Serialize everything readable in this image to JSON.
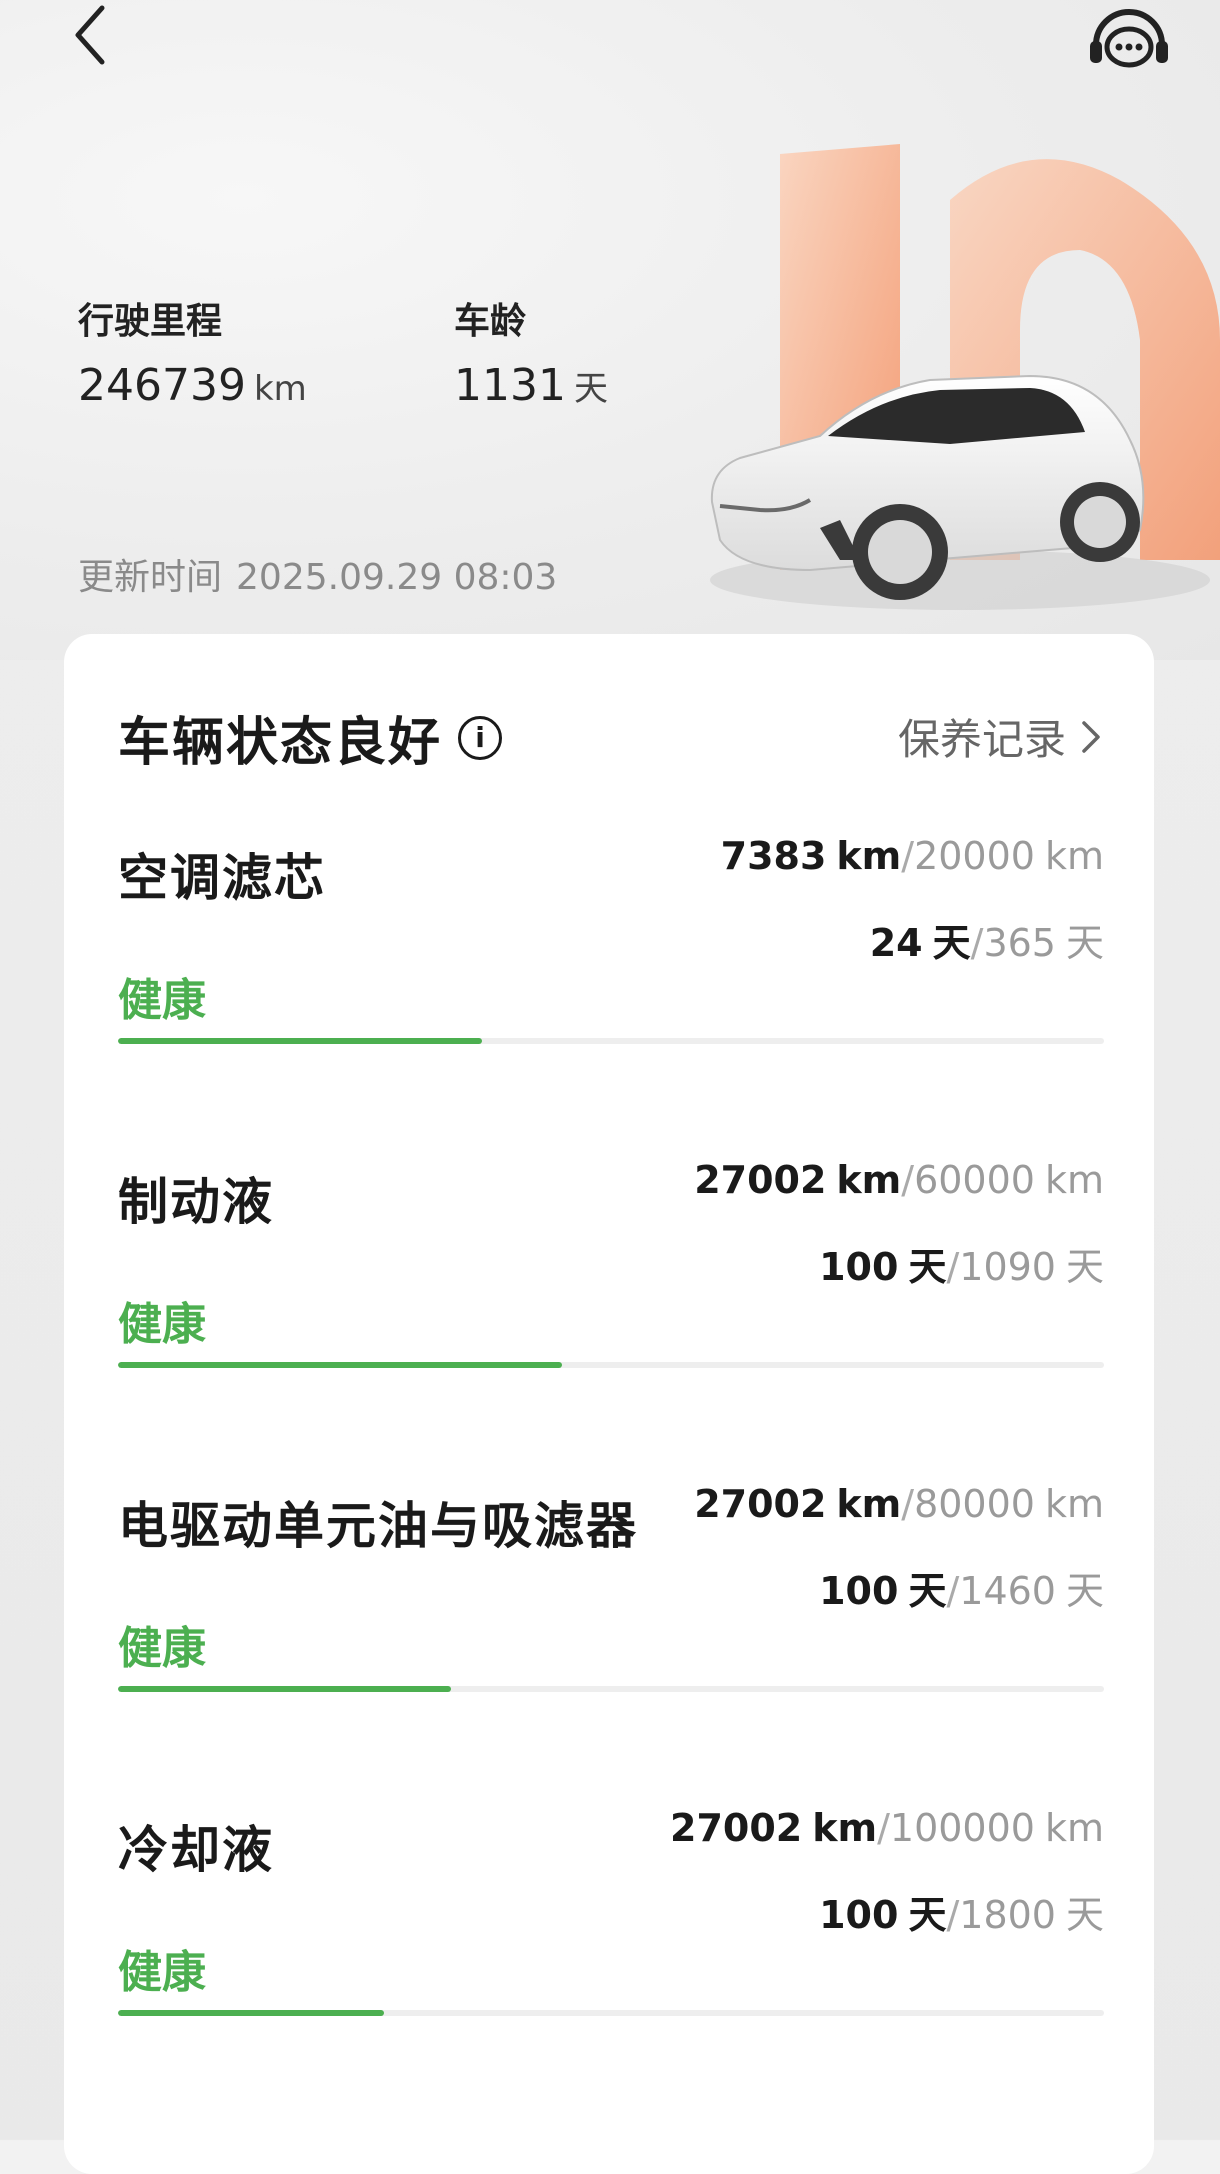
{
  "stats": {
    "mileage_label": "行驶里程",
    "mileage_value": "246739",
    "mileage_unit": "km",
    "age_label": "车龄",
    "age_value": "1131",
    "age_unit": "天"
  },
  "update": {
    "label": "更新时间",
    "time": "2025.09.29 08:03"
  },
  "card": {
    "title": "车辆状态良好",
    "info_icon": "i",
    "record_link": "保养记录"
  },
  "items": [
    {
      "name": "空调滤芯",
      "km_current": "7383",
      "km_limit": "20000",
      "day_current": "24",
      "day_limit": "365",
      "km_unit": "km",
      "day_unit": "天",
      "sep": "/",
      "status": "健康",
      "progress": 0.369
    },
    {
      "name": "制动液",
      "km_current": "27002",
      "km_limit": "60000",
      "day_current": "100",
      "day_limit": "1090",
      "km_unit": "km",
      "day_unit": "天",
      "sep": "/",
      "status": "健康",
      "progress": 0.45
    },
    {
      "name": "电驱动单元油与吸滤器",
      "km_current": "27002",
      "km_limit": "80000",
      "day_current": "100",
      "day_limit": "1460",
      "km_unit": "km",
      "day_unit": "天",
      "sep": "/",
      "status": "健康",
      "progress": 0.338
    },
    {
      "name": "冷却液",
      "km_current": "27002",
      "km_limit": "100000",
      "day_current": "100",
      "day_limit": "1800",
      "km_unit": "km",
      "day_unit": "天",
      "sep": "/",
      "status": "健康",
      "progress": 0.27
    }
  ],
  "icons": {
    "back": "chevron-left-icon",
    "support": "headset-chat-icon",
    "info": "info-icon",
    "chevron": "chevron-right-icon"
  },
  "colors": {
    "health": "#4caf50",
    "accent_orange": "#f5a07a"
  }
}
